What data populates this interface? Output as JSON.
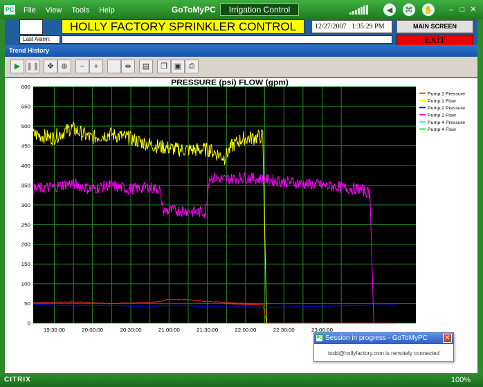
{
  "menu": [
    "File",
    "View",
    "Tools",
    "Help"
  ],
  "brand": "GoToMyPC",
  "session_title": "Irrigation Control",
  "logo_text": "PC",
  "hmi": {
    "title": "HOLLY FACTORY SPRINKLER CONTROL",
    "datetime": "12/27/2007   1:35:29 PM",
    "main_screen": "MAIN SCREEN",
    "last_alarm_label": "Last Alarm:",
    "last_alarm_value": "",
    "exit": "EXIT"
  },
  "trend": {
    "window_title": "Trend History"
  },
  "popup": {
    "title": "Session in progress - GoToMyPC",
    "message": "todd@hollyfactory.com is remotely connected"
  },
  "status": {
    "brand": "CITRIX",
    "zoom": "100%"
  },
  "colors": {
    "pump1_pressure": "#ff2a00",
    "pump1_flow": "#ffff00",
    "pump2_pressure": "#0000ff",
    "pump2_flow": "#ff00ff",
    "pump4_pressure": "#00ffff",
    "pump4_flow": "#00ff00"
  },
  "chart_data": {
    "type": "line",
    "title": "PRESSURE (psi)   FLOW (gpm)",
    "ylim": [
      0,
      600
    ],
    "yticks": [
      0,
      50,
      100,
      150,
      200,
      250,
      300,
      350,
      400,
      450,
      500,
      550,
      600
    ],
    "xticks": [
      "19:30:00",
      "20:00:00",
      "20:30:00",
      "21:00:00",
      "21:30:00",
      "22:00:00",
      "22:30:00",
      "23:00:00"
    ],
    "legend_position": "top-right",
    "series": [
      {
        "name": "Pump 1 Pressure",
        "color": "#ff2a00",
        "points": [
          [
            0,
            52
          ],
          [
            0.1,
            54
          ],
          [
            0.2,
            50
          ],
          [
            0.3,
            52
          ],
          [
            0.33,
            55
          ],
          [
            0.35,
            60
          ],
          [
            0.4,
            60
          ],
          [
            0.45,
            55
          ],
          [
            0.52,
            52
          ],
          [
            0.58,
            48
          ],
          [
            0.5,
            50
          ],
          [
            0.6,
            48
          ],
          [
            0.61,
            0
          ],
          [
            0.95,
            0
          ]
        ]
      },
      {
        "name": "Pump 1 Flow",
        "color": "#ffff00",
        "points": [
          [
            0,
            480
          ],
          [
            0.05,
            470
          ],
          [
            0.1,
            495
          ],
          [
            0.15,
            470
          ],
          [
            0.2,
            480
          ],
          [
            0.25,
            470
          ],
          [
            0.28,
            460
          ],
          [
            0.32,
            450
          ],
          [
            0.38,
            440
          ],
          [
            0.43,
            440
          ],
          [
            0.46,
            440
          ],
          [
            0.5,
            420
          ],
          [
            0.52,
            450
          ],
          [
            0.55,
            470
          ],
          [
            0.58,
            470
          ],
          [
            0.6,
            475
          ],
          [
            0.61,
            0
          ]
        ]
      },
      {
        "name": "Pump 2 Pressure",
        "color": "#0000ff",
        "points": [
          [
            0,
            48
          ],
          [
            0.05,
            46
          ],
          [
            0.1,
            44
          ],
          [
            0.2,
            45
          ],
          [
            0.3,
            42
          ],
          [
            0.35,
            45
          ],
          [
            0.4,
            45
          ],
          [
            0.45,
            42
          ],
          [
            0.5,
            42
          ],
          [
            0.55,
            42
          ],
          [
            0.6,
            40
          ],
          [
            0.7,
            42
          ],
          [
            0.8,
            44
          ],
          [
            0.9,
            46
          ],
          [
            0.95,
            47
          ]
        ]
      },
      {
        "name": "Pump 2 Flow",
        "color": "#ff00ff",
        "points": [
          [
            0,
            340
          ],
          [
            0.05,
            345
          ],
          [
            0.1,
            355
          ],
          [
            0.15,
            340
          ],
          [
            0.2,
            350
          ],
          [
            0.25,
            340
          ],
          [
            0.3,
            345
          ],
          [
            0.33,
            340
          ],
          [
            0.34,
            285
          ],
          [
            0.4,
            285
          ],
          [
            0.45,
            280
          ],
          [
            0.46,
            370
          ],
          [
            0.5,
            365
          ],
          [
            0.55,
            370
          ],
          [
            0.6,
            365
          ],
          [
            0.65,
            360
          ],
          [
            0.7,
            355
          ],
          [
            0.75,
            350
          ],
          [
            0.8,
            345
          ],
          [
            0.85,
            340
          ],
          [
            0.88,
            330
          ],
          [
            0.89,
            0
          ]
        ]
      },
      {
        "name": "Pump 4 Pressure",
        "color": "#00ffff",
        "points": []
      },
      {
        "name": "Pump 4 Flow",
        "color": "#00ff00",
        "points": []
      }
    ]
  }
}
